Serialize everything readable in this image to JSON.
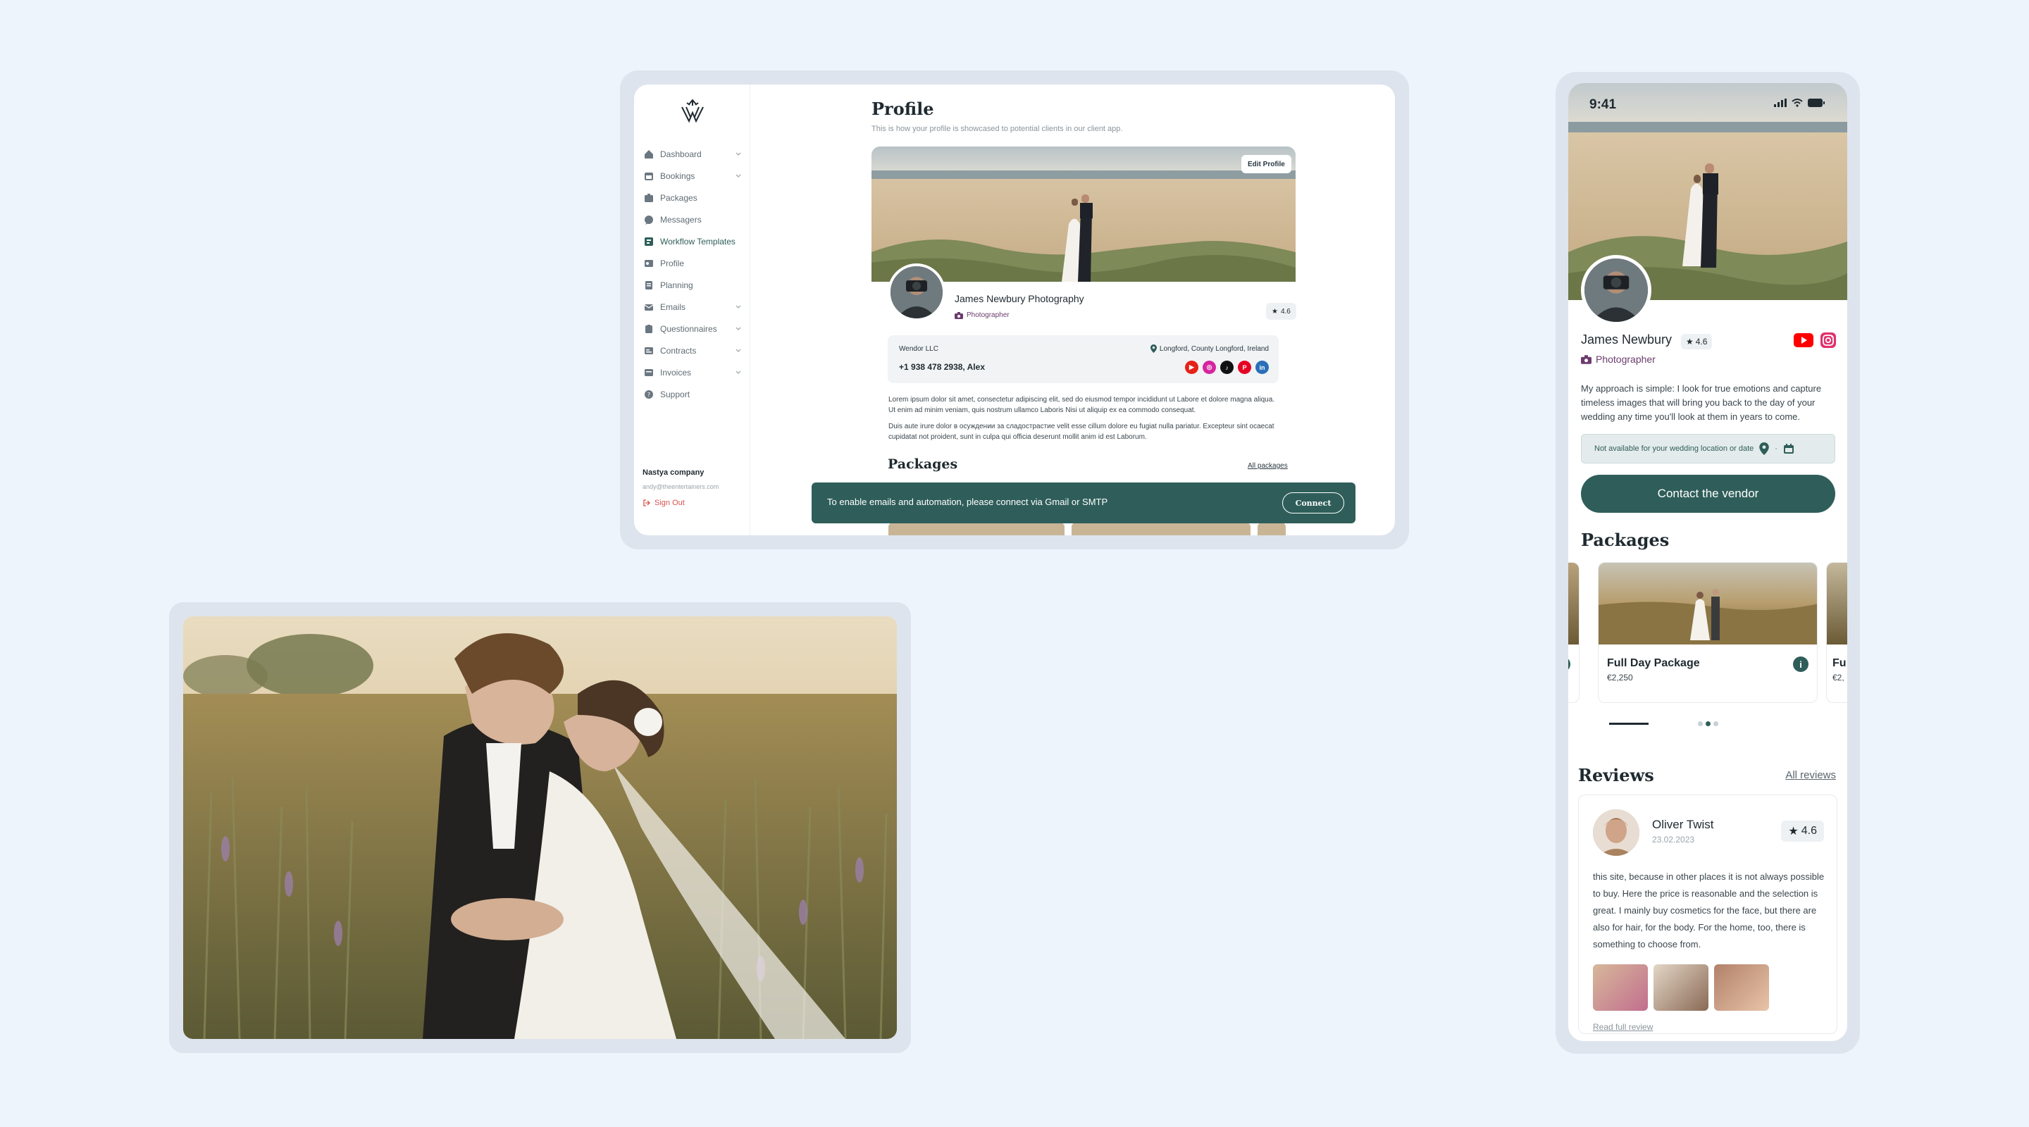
{
  "colors": {
    "primary": "#2f5e5a",
    "background": "#eef4fc",
    "role": "#6b3c6d",
    "danger": "#d9534f"
  },
  "sidebar": {
    "logo_icon": "wedding-rings-logo",
    "items": [
      {
        "label": "Dashboard",
        "icon": "home-icon",
        "chevron": true
      },
      {
        "label": "Bookings",
        "icon": "calendar-icon",
        "chevron": true
      },
      {
        "label": "Packages",
        "icon": "package-icon",
        "chevron": false
      },
      {
        "label": "Messagers",
        "icon": "chat-icon",
        "chevron": false
      },
      {
        "label": "Workflow Templates",
        "icon": "workflow-icon",
        "chevron": false,
        "active": true
      },
      {
        "label": "Profile",
        "icon": "id-card-icon",
        "chevron": false
      },
      {
        "label": "Planning",
        "icon": "planning-icon",
        "chevron": false
      },
      {
        "label": "Emails",
        "icon": "mail-icon",
        "chevron": true
      },
      {
        "label": "Questionnaires",
        "icon": "clipboard-icon",
        "chevron": true
      },
      {
        "label": "Contracts",
        "icon": "contract-icon",
        "chevron": true
      },
      {
        "label": "Invoices",
        "icon": "invoice-icon",
        "chevron": true
      },
      {
        "label": "Support",
        "icon": "help-icon",
        "chevron": false
      }
    ],
    "company": "Nastya company",
    "email": "andy@theentertainers.com",
    "sign_out": "Sign Out"
  },
  "profile": {
    "title": "Profile",
    "subtitle": "This is how your profile is showcased to potential clients in our client app.",
    "edit_button": "Edit Profile",
    "name": "James Newbury Photography",
    "role": "Photographer",
    "rating": "4.6",
    "vendor": "Wendor LLC",
    "phone": "+1 938 478 2938, Alex",
    "location": "Longford, County Longford, Ireland",
    "socials": [
      "youtube-icon",
      "instagram-icon",
      "tiktok-icon",
      "pinterest-icon",
      "linkedin-icon"
    ],
    "para1": "Lorem ipsum dolor sit amet, consectetur adipiscing elit, sed do eiusmod tempor incididunt ut Labore et dolore magna aliqua. Ut enim ad minim veniam, quis nostrum ullamco Laboris Nisi ut aliquip ex ea commodo consequat.",
    "para2": "Duis aute irure dolor в осуждении за сладострастие velit esse cillum dolore eu fugiat nulla pariatur. Excepteur sint ocaecat cupidatat not proident, sunt in culpa qui officia deserunt mollit anim id est Laborum.",
    "packages_heading": "Packages",
    "all_packages": "All packages"
  },
  "toast": {
    "text": "To enable emails and automation, please connect via Gmail or SMTP",
    "button": "Connect"
  },
  "phone": {
    "time": "9:41",
    "name": "James Newbury",
    "rating": "4.6",
    "role": "Photographer",
    "bio": "My approach is simple: I look for true emotions and capture timeless images that will bring you back to the day of your wedding any time you'll look at them in years to come.",
    "availability": "Not available for your wedding location or date",
    "contact_button": "Contact the vendor",
    "packages_heading": "Packages",
    "packages": [
      {
        "title": "Full Day Package",
        "price": "€2,250"
      },
      {
        "title": "Fu",
        "price": "€2,"
      }
    ],
    "reviews_heading": "Reviews",
    "all_reviews": "All reviews",
    "review": {
      "name": "Oliver Twist",
      "date": "23.02.2023",
      "rating": "4.6",
      "text": "this site, because in other places it is not always possible to buy. Here the price is reasonable and the selection is great. I mainly buy cosmetics for the face, but there are also for hair, for the body. For the home, too, there is something to choose from.",
      "read_full": "Read full review"
    }
  }
}
